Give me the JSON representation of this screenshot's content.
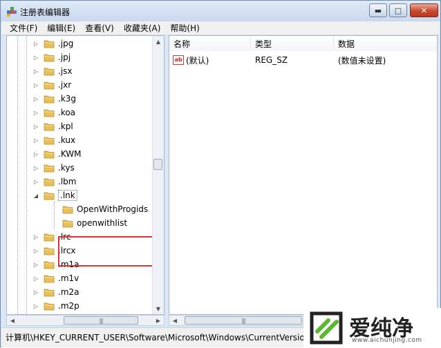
{
  "window": {
    "title": "注册表编辑器",
    "buttons": {
      "minimize": "▬",
      "maximize": "□",
      "close": "✕"
    }
  },
  "menu": [
    "文件(F)",
    "编辑(E)",
    "查看(V)",
    "收藏夹(A)",
    "帮助(H)"
  ],
  "tree": {
    "items": [
      {
        "label": ".jpg",
        "expander": "▷",
        "level": 1
      },
      {
        "label": ".jpj",
        "expander": "▷",
        "level": 1
      },
      {
        "label": ".jsx",
        "expander": "▷",
        "level": 1
      },
      {
        "label": ".jxr",
        "expander": "▷",
        "level": 1
      },
      {
        "label": ".k3g",
        "expander": "▷",
        "level": 1
      },
      {
        "label": ".koa",
        "expander": "▷",
        "level": 1
      },
      {
        "label": ".kpl",
        "expander": "▷",
        "level": 1
      },
      {
        "label": ".kux",
        "expander": "▷",
        "level": 1
      },
      {
        "label": ".KWM",
        "expander": "▷",
        "level": 1
      },
      {
        "label": ".kys",
        "expander": "▷",
        "level": 1
      },
      {
        "label": ".lbm",
        "expander": "▷",
        "level": 1
      },
      {
        "label": ".lnk",
        "expander": "◢",
        "level": 1,
        "selected": true
      },
      {
        "label": "OpenWithProgids",
        "expander": "",
        "level": 2
      },
      {
        "label": "openwithlist",
        "expander": "",
        "level": 2
      },
      {
        "label": ".lrc",
        "expander": "▷",
        "level": 1
      },
      {
        "label": ".lrcx",
        "expander": "▷",
        "level": 1
      },
      {
        "label": ".m1a",
        "expander": "▷",
        "level": 1
      },
      {
        "label": ".m1v",
        "expander": "▷",
        "level": 1
      },
      {
        "label": ".m2a",
        "expander": "▷",
        "level": 1
      },
      {
        "label": ".m2p",
        "expander": "▷",
        "level": 1
      }
    ]
  },
  "values_pane": {
    "columns": [
      "名称",
      "类型",
      "数据"
    ],
    "rows": [
      {
        "icon": "ab",
        "name": "(默认)",
        "type": "REG_SZ",
        "data": "(数值未设置)"
      }
    ]
  },
  "scroll": {
    "up": "▲",
    "down": "▼",
    "left": "◀",
    "right": "▶",
    "grip": "|||"
  },
  "statusbar": {
    "path": "计算机\\HKEY_CURRENT_USER\\Software\\Microsoft\\Windows\\CurrentVersion\\Explorer\\FileExts\\.lnk"
  },
  "watermark": {
    "text": "爱纯净",
    "url": "www.aichunjing.com"
  },
  "colors": {
    "highlight_border": "#d23838",
    "folder": "#e8c05a",
    "titlebar": "#c9d9ee"
  }
}
